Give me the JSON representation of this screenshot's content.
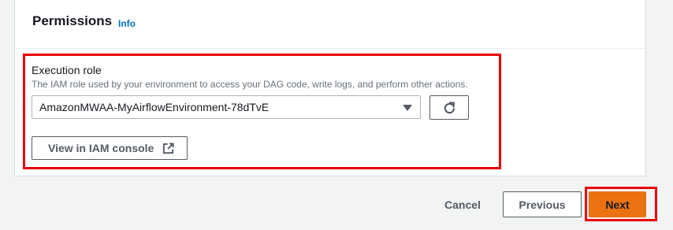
{
  "section": {
    "title": "Permissions",
    "info_link": "Info"
  },
  "execution_role": {
    "label": "Execution role",
    "description": "The IAM role used by your environment to access your DAG code, write logs, and perform other actions.",
    "selected_value": "AmazonMWAA-MyAirflowEnvironment-78dTvE",
    "view_iam_label": "View in IAM console"
  },
  "footer": {
    "cancel_label": "Cancel",
    "previous_label": "Previous",
    "next_label": "Next"
  },
  "icons": {
    "dropdown": "caret-down-icon",
    "refresh": "refresh-icon",
    "external": "external-link-icon"
  },
  "colors": {
    "primary": "#ec7211",
    "link": "#0073bb",
    "highlight": "#e8000b"
  }
}
